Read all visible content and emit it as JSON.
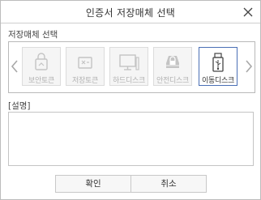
{
  "dialog": {
    "title": "인증서 저장매체 선택",
    "close_icon": "close-icon"
  },
  "media": {
    "section_label": "저장매체 선택",
    "prev_icon": "chevron-left-icon",
    "next_icon": "chevron-right-icon",
    "items": [
      {
        "label": "보안토큰",
        "icon": "security-token-icon",
        "selected": false
      },
      {
        "label": "저장토큰",
        "icon": "storage-token-icon",
        "selected": false
      },
      {
        "label": "하드디스크",
        "icon": "monitor-icon",
        "selected": false
      },
      {
        "label": "안전디스크",
        "icon": "safe-disk-icon",
        "selected": false
      },
      {
        "label": "이동디스크",
        "icon": "usb-drive-icon",
        "selected": true
      }
    ]
  },
  "description": {
    "label": "[설명]",
    "value": ""
  },
  "buttons": {
    "ok_label": "확인",
    "cancel_label": "취소"
  },
  "colors": {
    "selected_border": "#4a6fb5",
    "disabled_text": "#b2b2b2",
    "disabled_icon": "#c4c4c4"
  }
}
